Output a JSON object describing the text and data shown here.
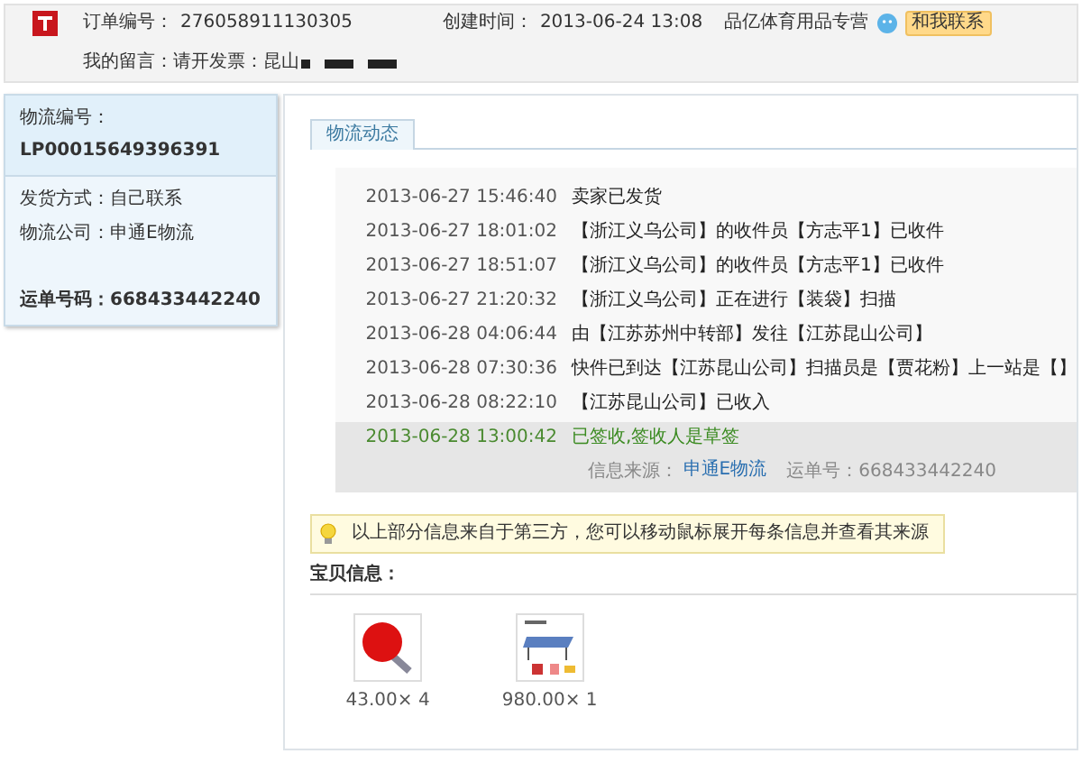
{
  "order": {
    "number_label": "订单编号：",
    "number": "276058911130305",
    "created_label": "创建时间：",
    "created": "2013-06-24 13:08",
    "shop": "品亿体育用品专营",
    "contact_button": "和我联系",
    "message_label": "我的留言：",
    "message": "请开发票：昆山"
  },
  "logistics": {
    "id_label": "物流编号：",
    "id": "LP00015649396391",
    "method_label": "发货方式：",
    "method": "自己联系",
    "company_label": "物流公司：",
    "company": "申通E物流",
    "waybill_label": "运单号码：",
    "waybill": "668433442240"
  },
  "tabs": [
    {
      "label": "物流动态",
      "selected": true
    }
  ],
  "events": [
    {
      "time": "2013-06-27 15:46:40",
      "text": "卖家已发货",
      "latest": false
    },
    {
      "time": "2013-06-27 18:01:02",
      "text": "【浙江义乌公司】的收件员【方志平1】已收件",
      "latest": false
    },
    {
      "time": "2013-06-27 18:51:07",
      "text": "【浙江义乌公司】的收件员【方志平1】已收件",
      "latest": false
    },
    {
      "time": "2013-06-27 21:20:32",
      "text": "【浙江义乌公司】正在进行【装袋】扫描",
      "latest": false
    },
    {
      "time": "2013-06-28 04:06:44",
      "text": "由【江苏苏州中转部】发往【江苏昆山公司】",
      "latest": false
    },
    {
      "time": "2013-06-28 07:30:36",
      "text": "快件已到达【江苏昆山公司】扫描员是【贾花粉】上一站是【】",
      "latest": false
    },
    {
      "time": "2013-06-28 08:22:10",
      "text": "【江苏昆山公司】已收入",
      "latest": false
    },
    {
      "time": "2013-06-28 13:00:42",
      "text": "已签收,签收人是草签",
      "latest": true
    }
  ],
  "source": {
    "label": "信息来源：",
    "link": "申通E物流",
    "waybill_label": "运单号：",
    "waybill": "668433442240"
  },
  "notice": "以上部分信息来自于第三方，您可以移动鼠标展开每条信息并查看其来源",
  "items_title": "宝贝信息：",
  "items": [
    {
      "kind": "paddle",
      "caption": "43.00× 4"
    },
    {
      "kind": "table",
      "caption": "980.00× 1"
    }
  ]
}
